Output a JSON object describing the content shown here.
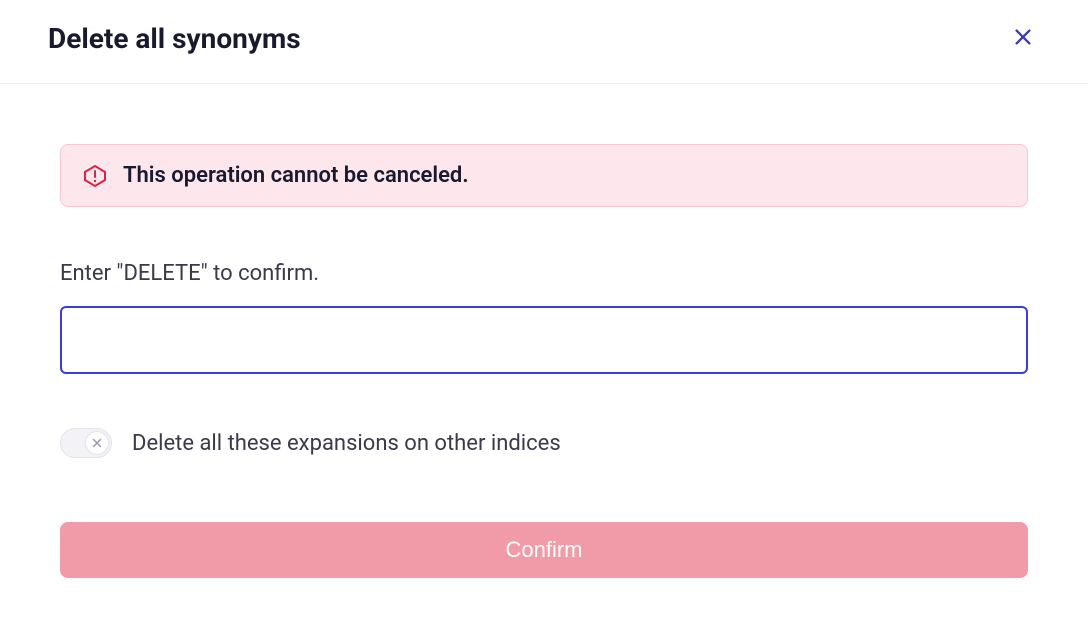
{
  "header": {
    "title": "Delete all synonyms"
  },
  "alert": {
    "message": "This operation cannot be canceled."
  },
  "form": {
    "input_label": "Enter \"DELETE\" to confirm.",
    "input_value": "",
    "toggle_label": "Delete all these expansions on other indices",
    "toggle_on": false,
    "confirm_label": "Confirm"
  },
  "colors": {
    "alert_bg": "#fde7ec",
    "alert_border": "#f9c7d2",
    "alert_icon": "#d6244a",
    "input_border": "#3d3bdd",
    "confirm_bg": "#f19aa8",
    "close_icon": "#3b3bb3"
  }
}
